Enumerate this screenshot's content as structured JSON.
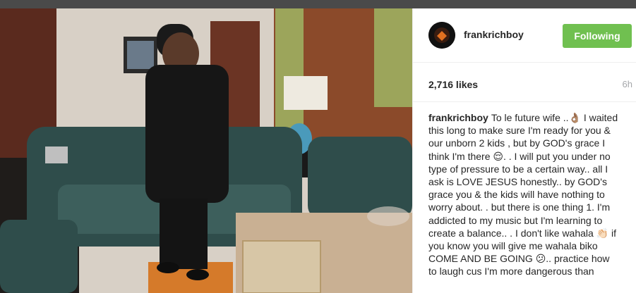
{
  "post": {
    "username": "frankrichboy",
    "follow_label": "Following",
    "likes": "2,716 likes",
    "time": "6h",
    "caption": "To le future wife ..👌🏽 I waited this long to make sure I'm ready for you & our unborn 2 kids , but by GOD's grace I think I'm there 😌. . I will put you under no type of pressure to be a certain way.. all I ask is LOVE JESUS honestly.. by GOD's grace you & the kids will have nothing to worry about. . but there is one thing 1. I'm addicted to my music but I'm learning to create a balance.. . I don't like wahala 👏🏻 if you know you will give me wahala biko COME AND BE GOING 😕.. practice how to laugh cus I'm more dangerous than"
  },
  "icons": {
    "avatar": "profile-avatar-icon"
  },
  "colors": {
    "follow_button": "#70c050",
    "username": "#262626",
    "time": "#a5a7aa"
  }
}
